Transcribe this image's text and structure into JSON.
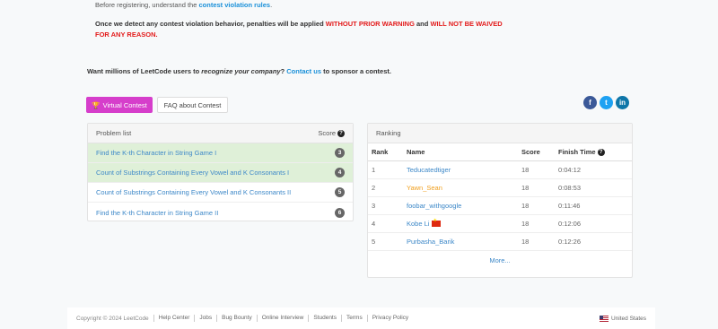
{
  "notice": {
    "line1_prefix": "Before registering, understand the ",
    "line1_link": "contest violation rules",
    "line1_suffix": ".",
    "warn_part1": "Once we detect any contest violation behavior, penalties will be applied ",
    "warn_red1": "WITHOUT PRIOR WARNING",
    "warn_part2": " and ",
    "warn_red2": "WILL NOT BE WAIVED FOR ANY REASON."
  },
  "sponsor": {
    "prefix": "Want millions of LeetCode users to ",
    "italic": "recognize your company",
    "mid": "? ",
    "link": "Contact us",
    "suffix": " to sponsor a contest."
  },
  "buttons": {
    "virtual_contest": "Virtual Contest",
    "faq": "FAQ about Contest"
  },
  "social": {
    "facebook": "f",
    "twitter": "t",
    "linkedin": "in"
  },
  "problems": {
    "header": "Problem list",
    "score_label": "Score",
    "items": [
      {
        "title": "Find the K-th Character in String Game I",
        "score": "3",
        "solved": true
      },
      {
        "title": "Count of Substrings Containing Every Vowel and K Consonants I",
        "score": "4",
        "solved": true
      },
      {
        "title": "Count of Substrings Containing Every Vowel and K Consonants II",
        "score": "5",
        "solved": false
      },
      {
        "title": "Find the K-th Character in String Game II",
        "score": "6",
        "solved": false
      }
    ]
  },
  "ranking": {
    "header": "Ranking",
    "columns": {
      "rank": "Rank",
      "name": "Name",
      "score": "Score",
      "finish": "Finish Time"
    },
    "rows": [
      {
        "rank": "1",
        "name": "Teducatedtiger",
        "score": "18",
        "time": "0:04:12"
      },
      {
        "rank": "2",
        "name": "Yawn_Sean",
        "score": "18",
        "time": "0:08:53"
      },
      {
        "rank": "3",
        "name": "foobar_withgoogle",
        "score": "18",
        "time": "0:11:46"
      },
      {
        "rank": "4",
        "name": "Kobe Li",
        "score": "18",
        "time": "0:12:06"
      },
      {
        "rank": "5",
        "name": "Purbasha_Barik",
        "score": "18",
        "time": "0:12:26"
      }
    ],
    "more": "More..."
  },
  "footer": {
    "copyright": "Copyright © 2024 LeetCode",
    "links": [
      "Help Center",
      "Jobs",
      "Bug Bounty",
      "Online Interview",
      "Students",
      "Terms",
      "Privacy Policy"
    ],
    "country": "United States"
  }
}
